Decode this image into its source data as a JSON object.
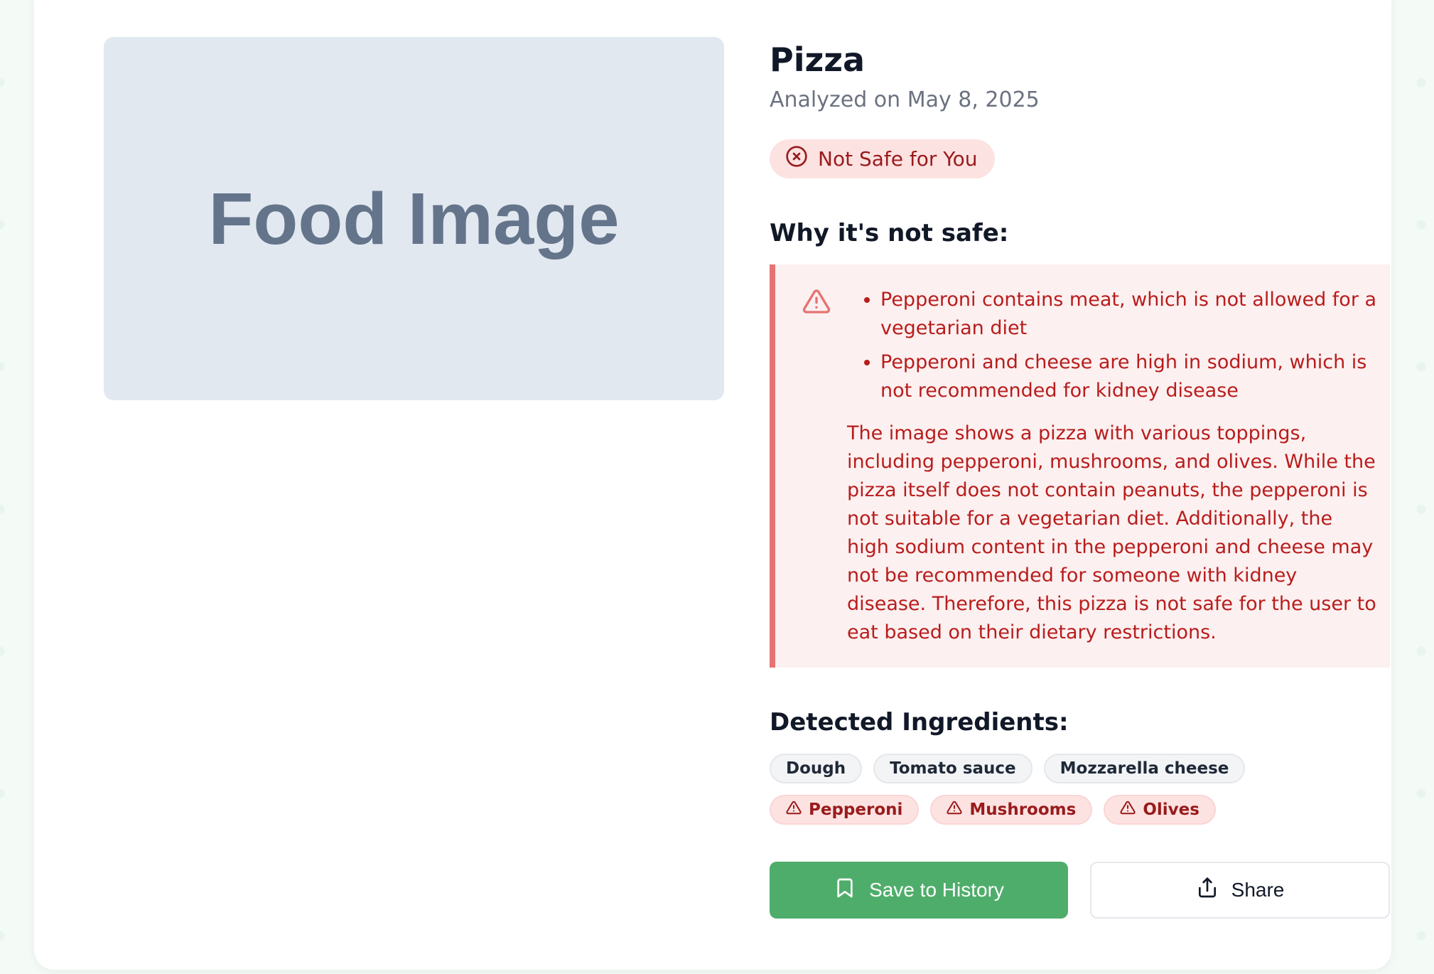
{
  "image_placeholder": {
    "label": "Food Image"
  },
  "food": {
    "name": "Pizza",
    "analyzed_text": "Analyzed on May 8, 2025"
  },
  "safety": {
    "status": "Not Safe for You",
    "status_icon": "x-circle-icon",
    "color": "#991b1b",
    "background": "#fde2e2"
  },
  "reasons": {
    "heading": "Why it's not safe:",
    "alert_icon": "warning-triangle-icon",
    "items": [
      "Pepperoni contains meat, which is not allowed for a vegetarian diet",
      "Pepperoni and cheese are high in sodium, which is not recommended for kidney disease"
    ],
    "explanation": "The image shows a pizza with various toppings, including pepperoni, mushrooms, and olives. While the pizza itself does not contain peanuts, the pepperoni is not suitable for a vegetarian diet. Additionally, the high sodium content in the pepperoni and cheese may not be recommended for someone with kidney disease. Therefore, this pizza is not safe for the user to eat based on their dietary restrictions."
  },
  "ingredients": {
    "heading": "Detected Ingredients:",
    "items": [
      {
        "name": "Dough",
        "flagged": false
      },
      {
        "name": "Tomato sauce",
        "flagged": false
      },
      {
        "name": "Mozzarella cheese",
        "flagged": false
      },
      {
        "name": "Pepperoni",
        "flagged": true
      },
      {
        "name": "Mushrooms",
        "flagged": true
      },
      {
        "name": "Olives",
        "flagged": true
      }
    ]
  },
  "actions": {
    "save_label": "Save to History",
    "save_icon": "bookmark-icon",
    "save_color": "#4fad6b",
    "share_label": "Share",
    "share_icon": "share-icon"
  }
}
